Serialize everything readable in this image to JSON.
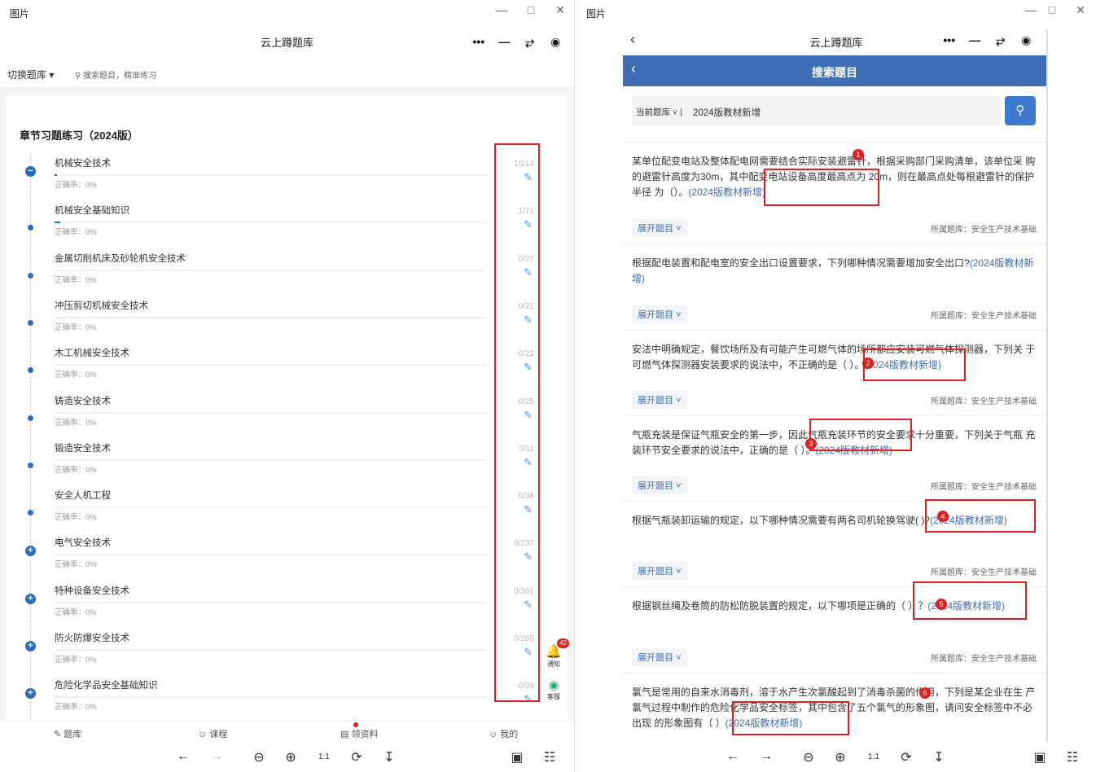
{
  "left": {
    "window_title": "图片",
    "mp_title": "云上蹲题库",
    "switch_bank": "切换题库",
    "search_hint": "搜索题目，精准练习",
    "section_title": "章节习题练习（2024版）",
    "chapters": [
      {
        "name": "机械安全技术",
        "accuracy": "正确率：0%",
        "count": "1/214",
        "icon": "minus-icon",
        "progress": 0.5
      },
      {
        "name": "机械安全基础知识",
        "accuracy": "正确率：0%",
        "count": "1/71",
        "icon": "dot-icon",
        "progress": 1.4
      },
      {
        "name": "金属切削机床及砂轮机安全技术",
        "accuracy": "正确率：0%",
        "count": "0/27",
        "icon": "dot-icon",
        "progress": 0
      },
      {
        "name": "冲压剪切机械安全技术",
        "accuracy": "正确率：0%",
        "count": "0/21",
        "icon": "dot-icon",
        "progress": 0
      },
      {
        "name": "木工机械安全技术",
        "accuracy": "正确率：0%",
        "count": "0/21",
        "icon": "dot-icon",
        "progress": 0
      },
      {
        "name": "铸造安全技术",
        "accuracy": "正确率：0%",
        "count": "0/25",
        "icon": "dot-icon",
        "progress": 0
      },
      {
        "name": "锻造安全技术",
        "accuracy": "正确率：0%",
        "count": "0/11",
        "icon": "dot-icon",
        "progress": 0
      },
      {
        "name": "安全人机工程",
        "accuracy": "正确率：0%",
        "count": "0/38",
        "icon": "dot-icon",
        "progress": 0
      },
      {
        "name": "电气安全技术",
        "accuracy": "正确率：0%",
        "count": "0/237",
        "icon": "plus-icon",
        "progress": 0
      },
      {
        "name": "特种设备安全技术",
        "accuracy": "正确率：0%",
        "count": "0/361",
        "icon": "plus-icon",
        "progress": 0
      },
      {
        "name": "防火防爆安全技术",
        "accuracy": "正确率：0%",
        "count": "0/265",
        "icon": "plus-icon",
        "progress": 0
      },
      {
        "name": "危险化学品安全基础知识",
        "accuracy": "正确率：0%",
        "count": "0/99",
        "icon": "plus-icon",
        "progress": 0
      }
    ],
    "notify_label": "通知",
    "notify_badge": "42",
    "service_label": "客服",
    "tabs": [
      "题库",
      "课程",
      "领资料",
      "我的"
    ]
  },
  "right": {
    "window_title": "图片",
    "mp_title": "云上蹲题库",
    "header_title": "搜索题目",
    "bank_label": "当前题库",
    "search_value": "2024版教材新增",
    "expand_label": "展开题目",
    "bank_name": "所属题库：安全生产技术基础",
    "questions": [
      {
        "text": "某单位配变电站及整体配电网需要结合实际安装避雷针，根据采购部门采购清单，该单位采 购的避雷针高度为30m，其中配变电站设备高度最高点为 20m，则在最高点处每根避雷针的保护半径 为（）。",
        "tag": "(2024版教材新增)",
        "num": "1"
      },
      {
        "text": "根据配电装置和配电室的安全出口设置要求，下列哪种情况需要增加安全出口?",
        "tag": "(2024版教材新增)",
        "num": ""
      },
      {
        "text": "安法中明确规定，餐饮场所及有可能产生可燃气体的场所都应安装可燃气体探测器，下列关 于可燃气体探测器安装要求的说法中，不正确的是（ ）。",
        "tag": "(2024版教材新增)",
        "num": "2"
      },
      {
        "text": "气瓶充装是保证气瓶安全的第一步，因此气瓶充装环节的安全要求十分重要，下列关于气瓶 充装环节安全要求的说法中，正确的是（ ）。",
        "tag": "(2024版教材新增)",
        "num": "3"
      },
      {
        "text": "根据气瓶装卸运输的规定，以下哪种情况需要有两名司机轮换驾驶(  )?",
        "tag": "(2024版教材新增)",
        "num": "4"
      },
      {
        "text": "根据钢丝绳及卷筒的防松防脱装置的规定，以下哪项是正确的（  ）？",
        "tag": "(2024版教材新增)",
        "num": "5"
      },
      {
        "text": "氯气是常用的自来水消毒剂，溶于水产生次氯酸起到了消毒杀菌的作用，下列是某企业在生 产氯气过程中制作的危险化学品安全标签，其中包含了五个氯气的形象图，请问安全标签中不必出现 的形象图有（ ）",
        "tag": "(2024版教材新增)",
        "num": "6"
      }
    ]
  }
}
